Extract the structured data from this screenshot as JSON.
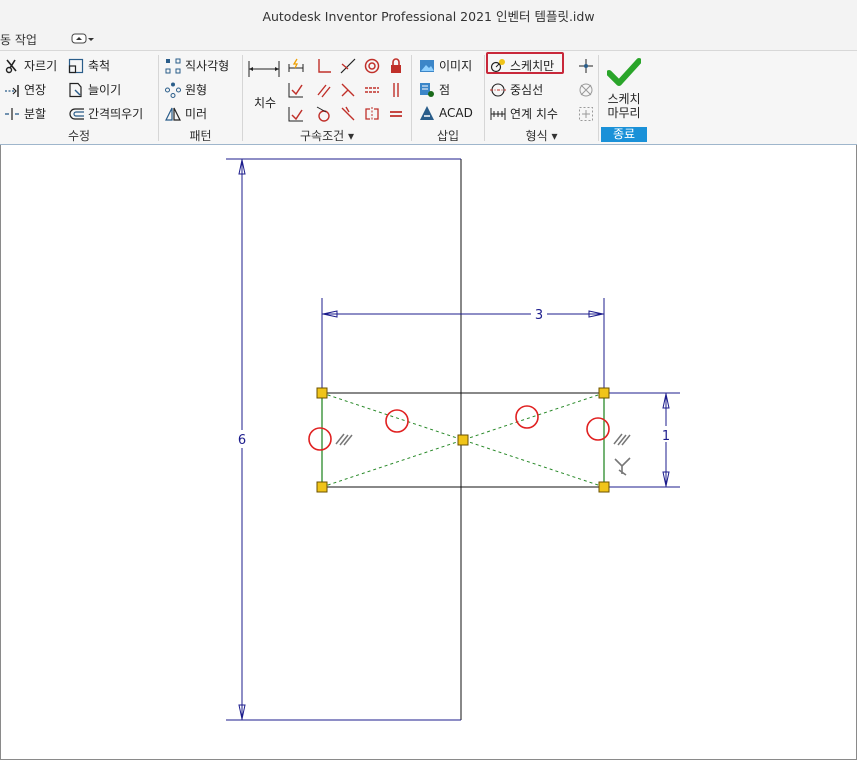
{
  "window": {
    "title": "Autodesk Inventor Professional 2021    인벤터 템플릿.idw"
  },
  "quick_access": {
    "label": "동 작업"
  },
  "ribbon": {
    "modify": {
      "label": "수정",
      "trim": "자르기",
      "scale": "축척",
      "extend": "연장",
      "stretch": "늘이기",
      "split": "분할",
      "offset": "간격띄우기"
    },
    "pattern": {
      "label": "패턴",
      "rect": "직사각형",
      "circular": "원형",
      "mirror": "미러"
    },
    "constrain": {
      "label": "구속조건",
      "dimension": "치수"
    },
    "insert": {
      "label": "삽입",
      "image": "이미지",
      "points": "점",
      "acad": "ACAD"
    },
    "format": {
      "label": "형식",
      "sketch_only": "스케치만",
      "centerline": "중심선",
      "driven_dim": "연계 치수"
    },
    "exit": {
      "label": "종료",
      "finish_line1": "스케치",
      "finish_line2": "마무리"
    }
  },
  "sketch": {
    "dim_width": "3",
    "dim_height_big": "6",
    "dim_height_small": "1"
  },
  "colors": {
    "dimension": "#1c1c8c",
    "sketch_line": "#111111",
    "construction": "#2a8a2a",
    "point_fill": "#f0c419",
    "marker": "#e02020",
    "finish_check": "#2aa52a",
    "highlight": "#c8283a"
  }
}
